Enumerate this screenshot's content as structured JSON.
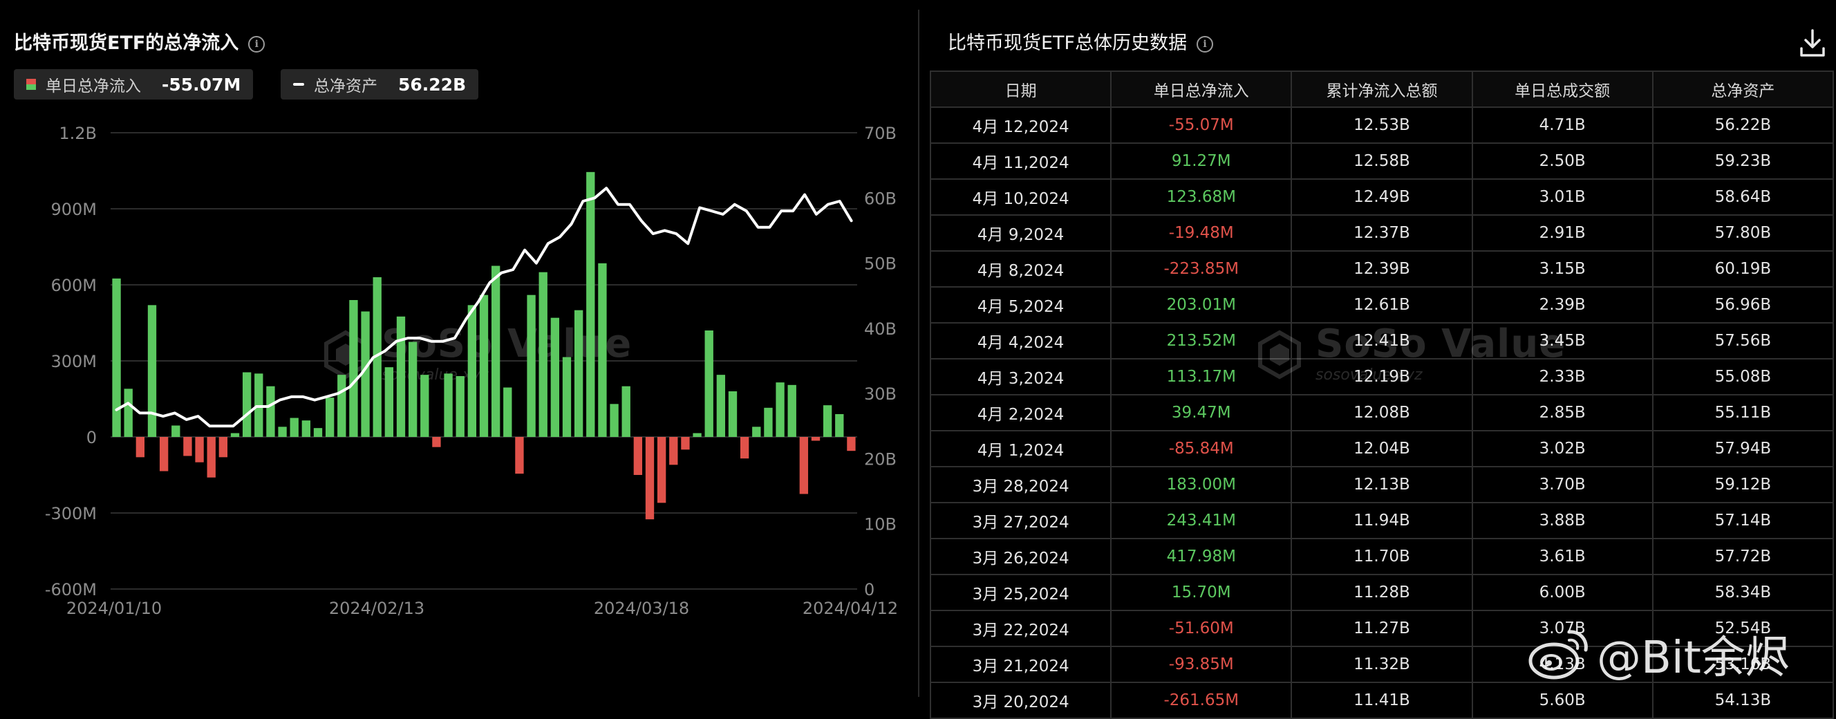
{
  "left_panel": {
    "title": "比特币现货ETF的总净流入",
    "legend": [
      {
        "label": "单日总净流入",
        "value": "-55.07M"
      },
      {
        "label": "总净资产",
        "value": "56.22B"
      }
    ]
  },
  "colors": {
    "positive": "#5cc860",
    "negative": "#e0524a",
    "line": "#ffffff",
    "grid": "#2c2c2c",
    "axis_text": "#8c8c8c"
  },
  "chart_data": {
    "type": "bar",
    "x_tick_labels": [
      "2024/01/10",
      "2024/02/13",
      "2024/03/18",
      "2024/04/12"
    ],
    "y_left": {
      "ticks": [
        "1.2B",
        "900M",
        "600M",
        "300M",
        "0",
        "-300M",
        "-600M"
      ],
      "ylim": [
        -600,
        1200
      ],
      "unit": "M"
    },
    "y_right": {
      "ticks": [
        "70B",
        "60B",
        "50B",
        "40B",
        "30B",
        "20B",
        "10B",
        "0"
      ],
      "ylim": [
        0,
        70
      ],
      "unit": "B"
    },
    "series": [
      {
        "type": "bar",
        "values": [
          625,
          190,
          -80,
          520,
          -135,
          45,
          -75,
          -100,
          -160,
          -80,
          15,
          255,
          250,
          200,
          40,
          75,
          65,
          35,
          155,
          245,
          540,
          495,
          630,
          275,
          475,
          375,
          245,
          -40,
          250,
          240,
          520,
          560,
          675,
          195,
          -145,
          560,
          650,
          470,
          315,
          500,
          1045,
          685,
          130,
          200,
          -150,
          -325,
          -260,
          -110,
          -50,
          15,
          420,
          245,
          180,
          -85,
          40,
          115,
          215,
          205,
          -225,
          -15,
          125,
          90,
          -55
        ]
      },
      {
        "type": "line",
        "values": [
          27.5,
          28.5,
          27,
          27,
          26.5,
          27,
          26,
          26.5,
          25,
          25,
          25,
          26.5,
          28,
          28,
          29,
          29.5,
          29.5,
          29,
          29.5,
          30,
          31,
          33,
          35.5,
          36.5,
          38,
          38.5,
          38.5,
          38,
          38,
          38.5,
          41.5,
          44,
          47,
          48.5,
          49,
          52,
          50,
          53,
          54,
          56,
          59.5,
          60,
          61.5,
          59,
          59,
          56.5,
          54.5,
          55,
          54.5,
          53,
          58.5,
          58,
          57.5,
          59,
          58,
          55.5,
          55.5,
          58,
          58,
          60.5,
          57.5,
          59,
          59.5,
          56.5
        ]
      }
    ]
  },
  "right_panel": {
    "title": "比特币现货ETF总体历史数据",
    "columns": [
      "日期",
      "单日总净流入",
      "累计净流入总额",
      "单日总成交额",
      "总净资产"
    ],
    "rows": [
      {
        "date": "4月 12,2024",
        "inflow": "-55.07M",
        "cumulative": "12.53B",
        "volume": "4.71B",
        "assets": "56.22B",
        "sign": "neg"
      },
      {
        "date": "4月 11,2024",
        "inflow": "91.27M",
        "cumulative": "12.58B",
        "volume": "2.50B",
        "assets": "59.23B",
        "sign": "pos"
      },
      {
        "date": "4月 10,2024",
        "inflow": "123.68M",
        "cumulative": "12.49B",
        "volume": "3.01B",
        "assets": "58.64B",
        "sign": "pos"
      },
      {
        "date": "4月 9,2024",
        "inflow": "-19.48M",
        "cumulative": "12.37B",
        "volume": "2.91B",
        "assets": "57.80B",
        "sign": "neg"
      },
      {
        "date": "4月 8,2024",
        "inflow": "-223.85M",
        "cumulative": "12.39B",
        "volume": "3.15B",
        "assets": "60.19B",
        "sign": "neg"
      },
      {
        "date": "4月 5,2024",
        "inflow": "203.01M",
        "cumulative": "12.61B",
        "volume": "2.39B",
        "assets": "56.96B",
        "sign": "pos"
      },
      {
        "date": "4月 4,2024",
        "inflow": "213.52M",
        "cumulative": "12.41B",
        "volume": "3.45B",
        "assets": "57.56B",
        "sign": "pos"
      },
      {
        "date": "4月 3,2024",
        "inflow": "113.17M",
        "cumulative": "12.19B",
        "volume": "2.33B",
        "assets": "55.08B",
        "sign": "pos"
      },
      {
        "date": "4月 2,2024",
        "inflow": "39.47M",
        "cumulative": "12.08B",
        "volume": "2.85B",
        "assets": "55.11B",
        "sign": "pos"
      },
      {
        "date": "4月 1,2024",
        "inflow": "-85.84M",
        "cumulative": "12.04B",
        "volume": "3.02B",
        "assets": "57.94B",
        "sign": "neg"
      },
      {
        "date": "3月 28,2024",
        "inflow": "183.00M",
        "cumulative": "12.13B",
        "volume": "3.70B",
        "assets": "59.12B",
        "sign": "pos"
      },
      {
        "date": "3月 27,2024",
        "inflow": "243.41M",
        "cumulative": "11.94B",
        "volume": "3.88B",
        "assets": "57.14B",
        "sign": "pos"
      },
      {
        "date": "3月 26,2024",
        "inflow": "417.98M",
        "cumulative": "11.70B",
        "volume": "3.61B",
        "assets": "57.72B",
        "sign": "pos"
      },
      {
        "date": "3月 25,2024",
        "inflow": "15.70M",
        "cumulative": "11.28B",
        "volume": "6.00B",
        "assets": "58.34B",
        "sign": "pos"
      },
      {
        "date": "3月 22,2024",
        "inflow": "-51.60M",
        "cumulative": "11.27B",
        "volume": "3.07B",
        "assets": "52.54B",
        "sign": "neg"
      },
      {
        "date": "3月 21,2024",
        "inflow": "-93.85M",
        "cumulative": "11.32B",
        "volume": "4.13B",
        "assets": "53.16B",
        "sign": "neg"
      },
      {
        "date": "3月 20,2024",
        "inflow": "-261.65M",
        "cumulative": "11.41B",
        "volume": "5.60B",
        "assets": "54.13B",
        "sign": "neg"
      }
    ]
  },
  "watermark": {
    "brand": "SoSo Value",
    "url": "sosovalue.xyz"
  },
  "weibo": {
    "handle": "@Bit余烬"
  }
}
